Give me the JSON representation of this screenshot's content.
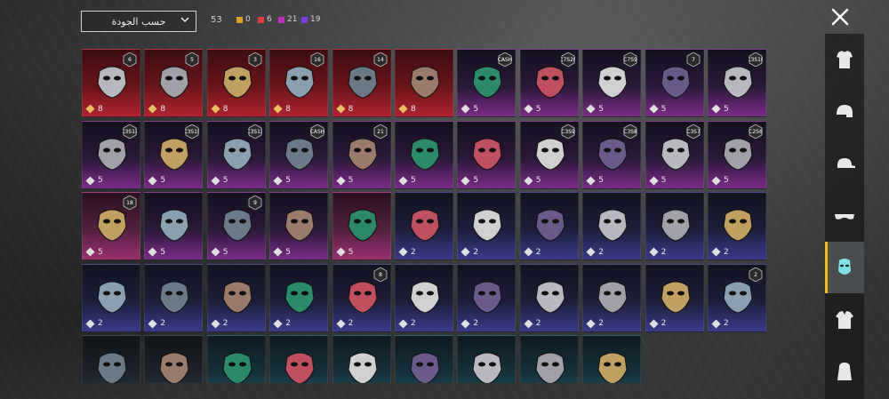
{
  "sort": {
    "label": "حسب الجودة"
  },
  "total_count": "53",
  "quality_counts": [
    {
      "value": "0",
      "color": "#e0a020"
    },
    {
      "value": "6",
      "color": "#e03a3a"
    },
    {
      "value": "21",
      "color": "#c030c0"
    },
    {
      "value": "19",
      "color": "#7a40e0"
    }
  ],
  "items": [
    {
      "rarity": "red",
      "cost": "8",
      "badge": "6",
      "icon": "plague-doctor-mask-icon"
    },
    {
      "rarity": "red",
      "cost": "8",
      "badge": "5",
      "icon": "cyber-helmet-icon"
    },
    {
      "rarity": "red",
      "cost": "8",
      "badge": "3",
      "icon": "wolf-mask-icon"
    },
    {
      "rarity": "red",
      "cost": "8",
      "badge": "16",
      "icon": "gold-tribal-mask-icon"
    },
    {
      "rarity": "red",
      "cost": "8",
      "badge": "14",
      "icon": "blue-armor-mask-icon"
    },
    {
      "rarity": "red",
      "cost": "8",
      "badge": "",
      "icon": "dark-helmet-icon"
    },
    {
      "rarity": "purple",
      "cost": "5",
      "badge": "CASH",
      "icon": "green-face-mask-icon"
    },
    {
      "rarity": "purple",
      "cost": "5",
      "badge": "C7S26",
      "icon": "teal-face-mask-icon"
    },
    {
      "rarity": "purple",
      "cost": "5",
      "badge": "C7S9",
      "icon": "gold-blue-mask-icon"
    },
    {
      "rarity": "purple",
      "cost": "5",
      "badge": "7",
      "icon": "glasses-icon"
    },
    {
      "rarity": "purple",
      "cost": "5",
      "badge": "C3S16",
      "icon": "golden-horns-icon"
    },
    {
      "rarity": "purple",
      "cost": "5",
      "badge": "C3S17",
      "icon": "teal-yellow-mask-icon"
    },
    {
      "rarity": "purple",
      "cost": "5",
      "badge": "C3S15",
      "icon": "yellow-respirator-icon"
    },
    {
      "rarity": "purple",
      "cost": "5",
      "badge": "C3S13",
      "icon": "graffiti-mask-icon"
    },
    {
      "rarity": "purple",
      "cost": "5",
      "badge": "CASH",
      "icon": "navy-face-mask-icon"
    },
    {
      "rarity": "purple",
      "cost": "5",
      "badge": "21",
      "icon": "oni-mask-icon"
    },
    {
      "rarity": "purple",
      "cost": "5",
      "badge": "",
      "icon": "kitsune-mask-icon"
    },
    {
      "rarity": "purple",
      "cost": "5",
      "badge": "",
      "icon": "gold-navy-mask-icon"
    },
    {
      "rarity": "purple",
      "cost": "5",
      "badge": "C3S9",
      "icon": "black-purple-mask-icon"
    },
    {
      "rarity": "purple",
      "cost": "5",
      "badge": "C3S8",
      "icon": "dark-gold-mask-icon"
    },
    {
      "rarity": "purple",
      "cost": "5",
      "badge": "C3S7",
      "icon": "gold-black-mask-icon"
    },
    {
      "rarity": "purple",
      "cost": "5",
      "badge": "C2S6",
      "icon": "purple-mesh-mask-icon"
    },
    {
      "rarity": "pink",
      "cost": "5",
      "badge": "18",
      "icon": "pink-striped-mask-icon"
    },
    {
      "rarity": "purple",
      "cost": "5",
      "badge": "",
      "icon": "black-cloth-mask-icon"
    },
    {
      "rarity": "purple",
      "cost": "5",
      "badge": "9",
      "icon": "dark-knight-helmet-icon"
    },
    {
      "rarity": "purple",
      "cost": "5",
      "badge": "",
      "icon": "plague-mask-icon"
    },
    {
      "rarity": "pink",
      "cost": "5",
      "badge": "",
      "icon": "bandana-icon"
    },
    {
      "rarity": "blue",
      "cost": "2",
      "badge": "",
      "icon": "black-face-mask-icon"
    },
    {
      "rarity": "blue",
      "cost": "2",
      "badge": "",
      "icon": "robot-mouse-icon"
    },
    {
      "rarity": "blue",
      "cost": "2",
      "badge": "",
      "icon": "elephant-mask-icon"
    },
    {
      "rarity": "blue",
      "cost": "2",
      "badge": "",
      "icon": "pink-hippo-mask-icon"
    },
    {
      "rarity": "blue",
      "cost": "2",
      "badge": "",
      "icon": "masquerade-mask-icon"
    },
    {
      "rarity": "blue",
      "cost": "2",
      "badge": "",
      "icon": "purple-visor-mask-icon"
    },
    {
      "rarity": "blue",
      "cost": "2",
      "badge": "",
      "icon": "gas-mask-icon"
    },
    {
      "rarity": "blue",
      "cost": "2",
      "badge": "",
      "icon": "bandaged-face-icon"
    },
    {
      "rarity": "blue",
      "cost": "2",
      "badge": "",
      "icon": "gray-face-mask-icon"
    },
    {
      "rarity": "blue",
      "cost": "2",
      "badge": "",
      "icon": "mustache-icon"
    },
    {
      "rarity": "blue",
      "cost": "2",
      "badge": "8",
      "icon": "rusty-mask-icon"
    },
    {
      "rarity": "blue",
      "cost": "2",
      "badge": "",
      "icon": "kiss-face-mask-icon"
    },
    {
      "rarity": "blue",
      "cost": "2",
      "badge": "",
      "icon": "black-ninja-mask-icon"
    },
    {
      "rarity": "blue",
      "cost": "2",
      "badge": "",
      "icon": "black-cloth-mask-2-icon"
    },
    {
      "rarity": "blue",
      "cost": "2",
      "badge": "",
      "icon": "joker-mask-icon"
    },
    {
      "rarity": "blue",
      "cost": "2",
      "badge": "",
      "icon": "hockey-mask-icon"
    },
    {
      "rarity": "blue",
      "cost": "2",
      "badge": "2",
      "icon": "clown-mask-icon"
    },
    {
      "rarity": "gray",
      "cost": "",
      "badge": "",
      "icon": "skull-mask-icon"
    },
    {
      "rarity": "gray",
      "cost": "",
      "badge": "",
      "icon": "armored-mask-icon"
    },
    {
      "rarity": "teal",
      "cost": "",
      "badge": "",
      "icon": "gold-skull-mask-icon"
    },
    {
      "rarity": "teal",
      "cost": "",
      "badge": "",
      "icon": "yellow-mesh-mask-icon"
    },
    {
      "rarity": "teal",
      "cost": "",
      "badge": "",
      "icon": "green-mesh-mask-icon"
    },
    {
      "rarity": "teal",
      "cost": "",
      "badge": "",
      "icon": "purple-venetian-mask-icon"
    },
    {
      "rarity": "teal",
      "cost": "",
      "badge": "",
      "icon": "red-venetian-mask-icon"
    },
    {
      "rarity": "teal",
      "cost": "",
      "badge": "",
      "icon": "black-gold-mask-icon"
    },
    {
      "rarity": "teal",
      "cost": "",
      "badge": "",
      "icon": "spiked-mask-icon"
    }
  ],
  "categories": [
    {
      "icon": "shirt-icon",
      "active": false
    },
    {
      "icon": "helmet-icon",
      "active": false
    },
    {
      "icon": "cap-icon",
      "active": false
    },
    {
      "icon": "glasses-icon",
      "active": false
    },
    {
      "icon": "mask-icon",
      "active": true
    },
    {
      "icon": "jacket-icon",
      "active": false
    },
    {
      "icon": "bag-icon",
      "active": false
    }
  ],
  "colors": {
    "accent": "#f0c000",
    "active_icon": "#7fe0e8"
  }
}
